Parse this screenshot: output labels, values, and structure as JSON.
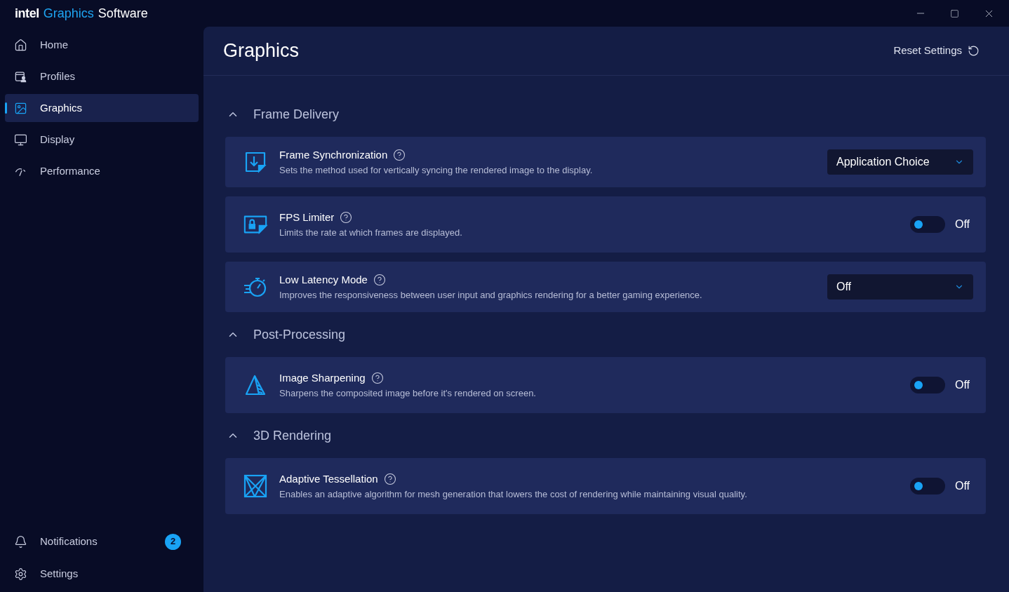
{
  "window": {
    "title": {
      "brand": "intel",
      "product": "Graphics",
      "suffix": "Software"
    }
  },
  "sidebar": {
    "items": [
      {
        "label": "Home",
        "selected": false
      },
      {
        "label": "Profiles",
        "selected": false
      },
      {
        "label": "Graphics",
        "selected": true
      },
      {
        "label": "Display",
        "selected": false
      },
      {
        "label": "Performance",
        "selected": false
      }
    ],
    "bottom_items": [
      {
        "label": "Notifications",
        "badge": "2"
      },
      {
        "label": "Settings"
      }
    ]
  },
  "page": {
    "title": "Graphics",
    "reset_button": "Reset Settings"
  },
  "sections": [
    {
      "title": "Frame Delivery",
      "expanded": true,
      "items": [
        {
          "kind": "dropdown",
          "title": "Frame Synchronization",
          "description": "Sets the method used for vertically syncing the rendered image to the display.",
          "value": "Application Choice"
        },
        {
          "kind": "toggle",
          "title": "FPS Limiter",
          "description": "Limits the rate at which frames are displayed.",
          "on": false,
          "value": "Off"
        },
        {
          "kind": "dropdown",
          "title": "Low Latency Mode",
          "description": "Improves the responsiveness between user input and graphics rendering for a better gaming experience.",
          "value": "Off"
        }
      ]
    },
    {
      "title": "Post-Processing",
      "expanded": true,
      "items": [
        {
          "kind": "toggle",
          "title": "Image Sharpening",
          "description": "Sharpens the composited image before it's rendered on screen.",
          "on": false,
          "value": "Off"
        }
      ]
    },
    {
      "title": "3D Rendering",
      "expanded": true,
      "items": [
        {
          "kind": "toggle",
          "title": "Adaptive Tessellation",
          "description": "Enables an adaptive algorithm for mesh generation that lowers the cost of rendering while maintaining visual quality.",
          "on": false,
          "value": "Off"
        }
      ]
    }
  ]
}
